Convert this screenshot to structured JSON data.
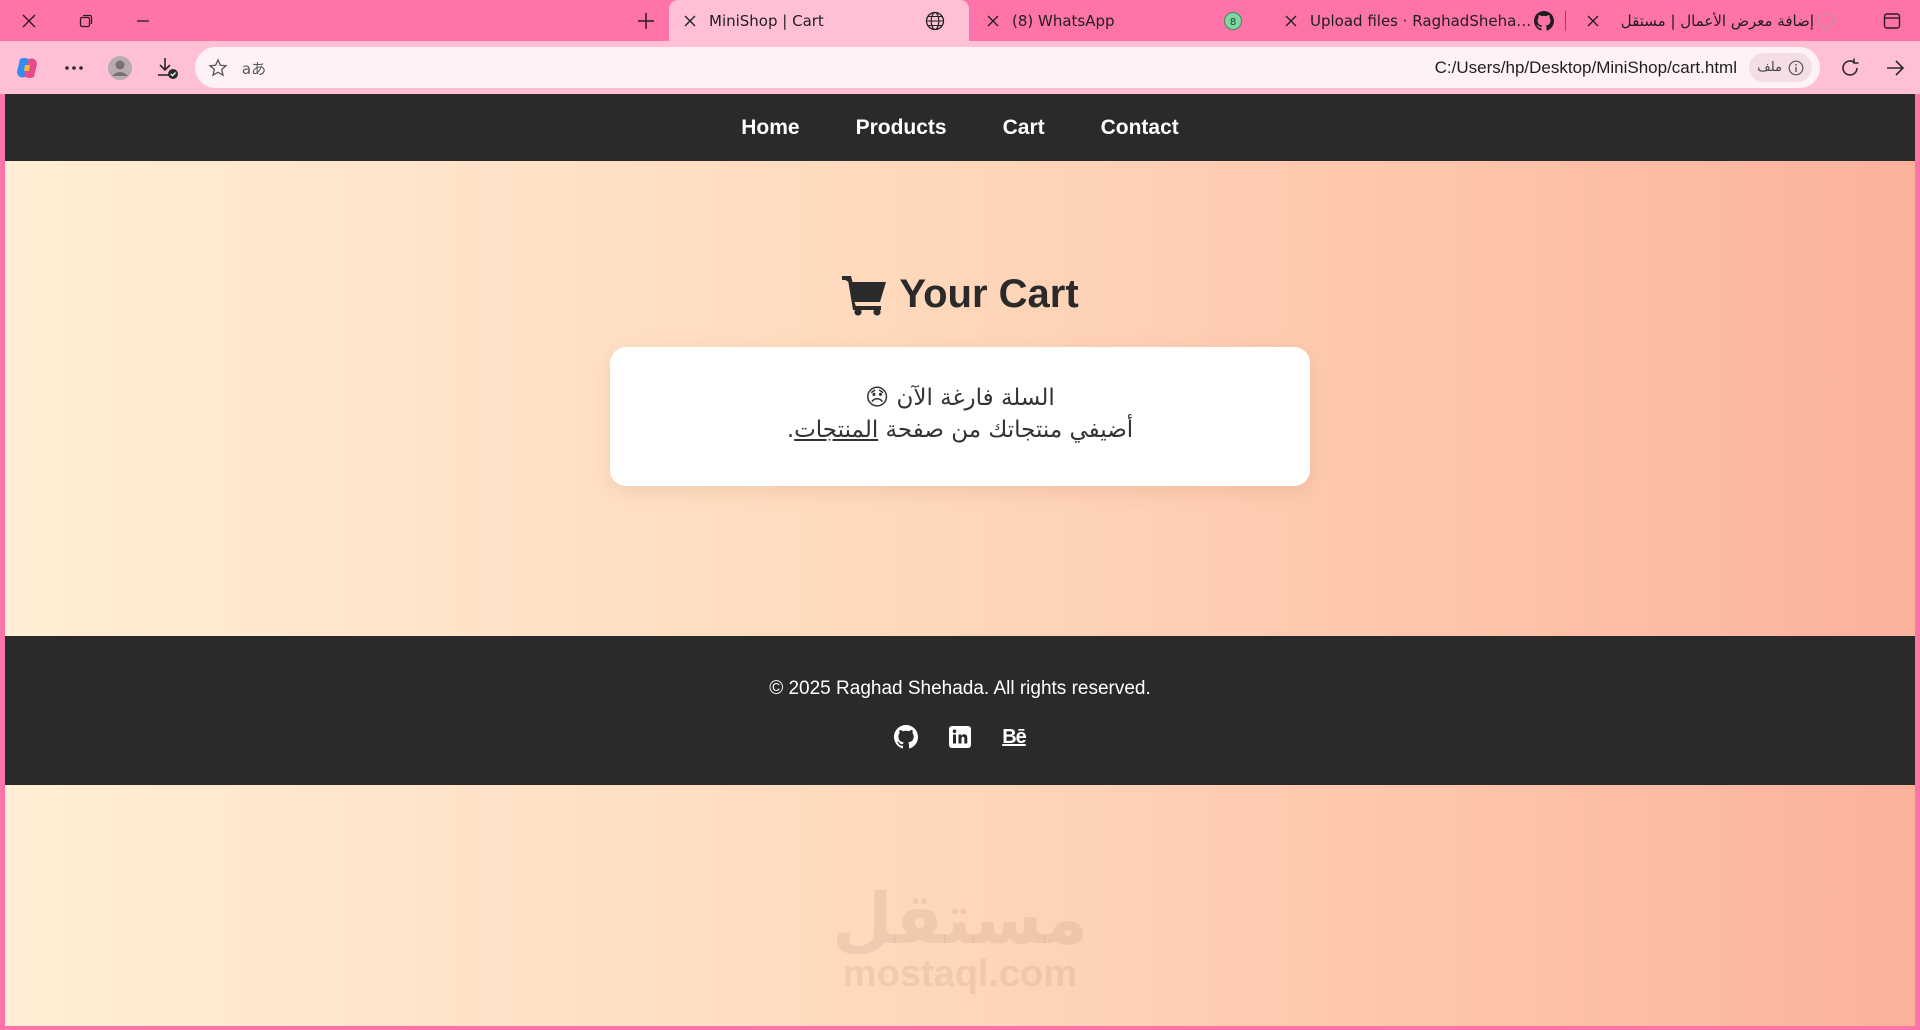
{
  "window": {
    "close_icon": "close-icon",
    "restore_icon": "restore-icon",
    "minimize_icon": "minimize-icon"
  },
  "tabs": [
    {
      "title": "MiniShop | Cart",
      "active": true
    },
    {
      "title": "(8) WhatsApp",
      "badge": "8"
    },
    {
      "title": "Upload files · RaghadShehada/Mi"
    },
    {
      "title": "إضافة معرض الأعمال | مستقل"
    }
  ],
  "toolbar": {
    "url": "C:/Users/hp/Desktop/MiniShop/cart.html",
    "file_chip": "ملف",
    "read_aloud": "aあ"
  },
  "page": {
    "nav": [
      "Home",
      "Products",
      "Cart",
      "Contact"
    ],
    "heading": "Your Cart",
    "empty_line1": "السلة فارغة الآن 😞",
    "empty_line2_prefix": "أضيفي منتجاتك من صفحة ",
    "empty_line2_link": "المنتجات",
    "empty_line2_suffix": ".",
    "footer_copy": "© 2025 Raghad Shehada. All rights reserved.",
    "socials": [
      "github-icon",
      "linkedin-icon",
      "behance-icon"
    ],
    "behance_label": "Bē",
    "watermark_ar": "مستقل",
    "watermark_en": "mostaql.com"
  },
  "colors": {
    "tabbar": "#ff74a8",
    "toolbar": "#ffc0d6",
    "navbar": "#2a2a2a",
    "gradient_start": "#ffeed5",
    "gradient_end": "#fbb19c"
  }
}
